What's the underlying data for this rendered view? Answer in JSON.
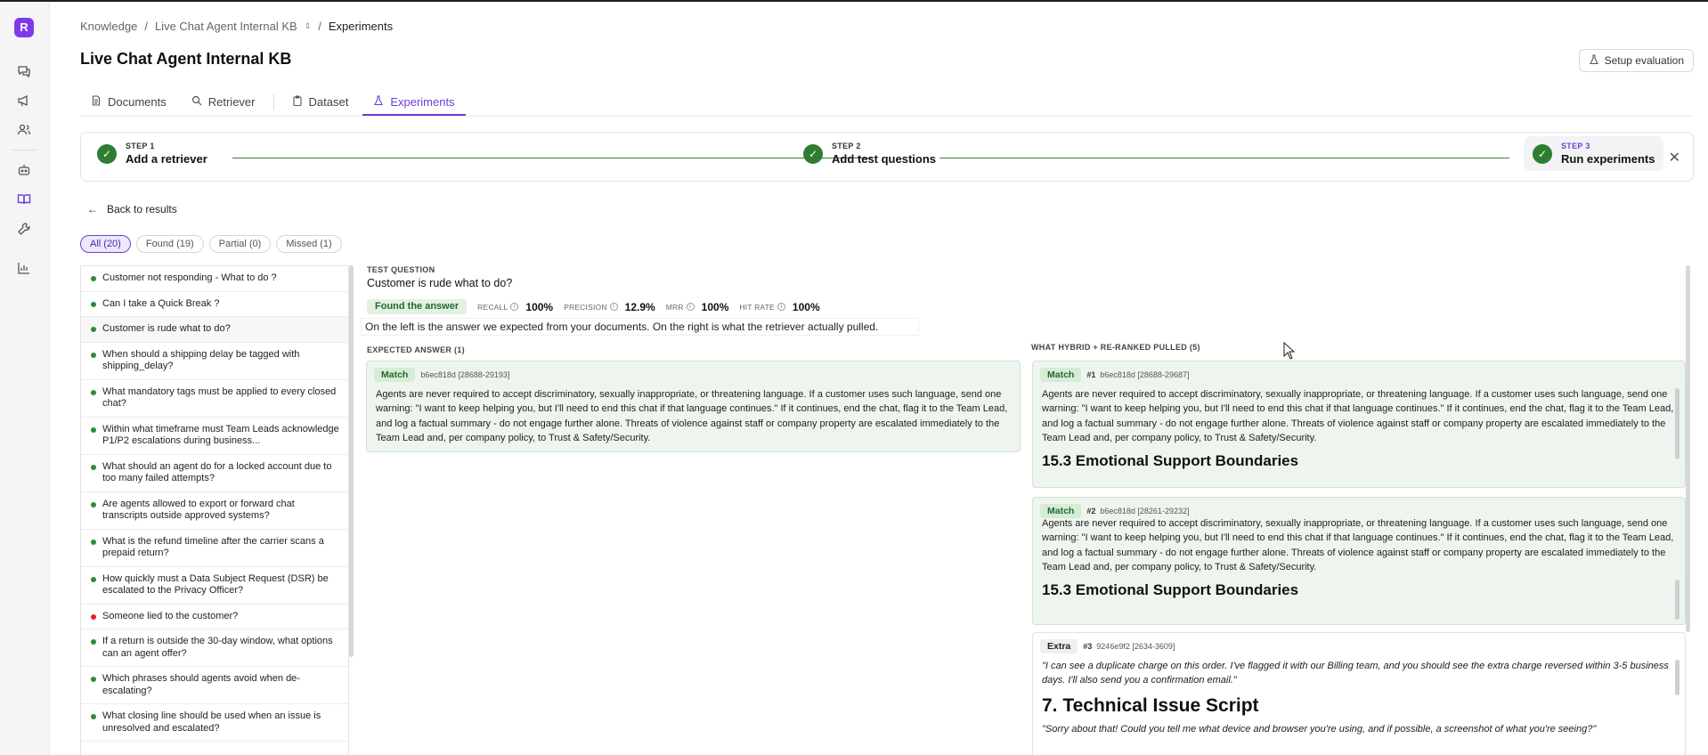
{
  "breadcrumb": {
    "root": "Knowledge",
    "kb": "Live Chat Agent Internal KB",
    "current": "Experiments"
  },
  "page": {
    "title": "Live Chat Agent Internal KB",
    "setup_button": "Setup evaluation"
  },
  "tabs": [
    {
      "label": "Documents",
      "icon": "document-icon"
    },
    {
      "label": "Retriever",
      "icon": "search-icon"
    },
    {
      "label": "Dataset",
      "icon": "clipboard-icon"
    },
    {
      "label": "Experiments",
      "icon": "flask-icon",
      "active": true
    }
  ],
  "steps": [
    {
      "step": "STEP 1",
      "label": "Add a retriever"
    },
    {
      "step": "STEP 2",
      "label": "Add test questions"
    },
    {
      "step": "STEP 3",
      "label": "Run experiments"
    }
  ],
  "back_label": "Back to results",
  "filters": [
    {
      "label": "All (20)",
      "active": true
    },
    {
      "label": "Found (19)"
    },
    {
      "label": "Partial (0)"
    },
    {
      "label": "Missed (1)"
    }
  ],
  "questions": [
    {
      "text": "Customer not responding - What to do ?",
      "status": "found"
    },
    {
      "text": "Can I take a Quick Break ?",
      "status": "found"
    },
    {
      "text": "Customer is rude what to do?",
      "status": "found",
      "selected": true
    },
    {
      "text": "When should a shipping delay be tagged with shipping_delay?",
      "status": "found"
    },
    {
      "text": "What mandatory tags must be applied to every closed chat?",
      "status": "found"
    },
    {
      "text": "Within what timeframe must Team Leads acknowledge P1/P2 escalations during business...",
      "status": "found"
    },
    {
      "text": "What should an agent do for a locked account due to too many failed attempts?",
      "status": "found"
    },
    {
      "text": "Are agents allowed to export or forward chat transcripts outside approved systems?",
      "status": "found"
    },
    {
      "text": "What is the refund timeline after the carrier scans a prepaid return?",
      "status": "found"
    },
    {
      "text": "How quickly must a Data Subject Request (DSR) be escalated to the Privacy Officer?",
      "status": "found"
    },
    {
      "text": "Someone lied to the customer?",
      "status": "missed"
    },
    {
      "text": "If a return is outside the 30-day window, what options can an agent offer?",
      "status": "found"
    },
    {
      "text": "Which phrases should agents avoid when de-escalating?",
      "status": "found"
    },
    {
      "text": "What closing line should be used when an issue is unresolved and escalated?",
      "status": "found"
    }
  ],
  "detail": {
    "tq_label": "TEST QUESTION",
    "question": "Customer is rude what to do?",
    "result": "Found the answer",
    "metrics": [
      {
        "label": "RECALL",
        "value": "100%"
      },
      {
        "label": "PRECISION",
        "value": "12.9%"
      },
      {
        "label": "MRR",
        "value": "100%"
      },
      {
        "label": "HIT RATE",
        "value": "100%"
      }
    ],
    "explanation": "On the left is the answer we expected from your documents. On the right is what the retriever actually pulled.",
    "expected_header": "EXPECTED ANSWER (1)",
    "pulled_header": "WHAT HYBRID + RE-RANKED PULLED (5)",
    "expected": {
      "badge": "Match",
      "id": "b6ec818d [28688-29193]",
      "text": "Agents are never required to accept discriminatory, sexually inappropriate, or threatening language. If a customer uses such language, send one warning: \"I want to keep helping you, but I'll need to end this chat if that language continues.\" If it continues, end the chat, flag it to the Team Lead, and log a factual summary - do not engage further alone. Threats of violence against staff or company property are escalated immediately to the Team Lead and, per company policy, to Trust & Safety/Security."
    },
    "pulled": [
      {
        "badge": "Match",
        "rank": "#1",
        "id": "b6ec818d [28688-29687]",
        "text": "Agents are never required to accept discriminatory, sexually inappropriate, or threatening language. If a customer uses such language, send one warning: \"I want to keep helping you, but I'll need to end this chat if that language continues.\" If it continues, end the chat, flag it to the Team Lead, and log a factual summary - do not engage further alone. Threats of violence against staff or company property are escalated immediately to the Team Lead and, per company policy, to Trust & Safety/Security.",
        "heading": "15.3 Emotional Support Boundaries"
      },
      {
        "badge": "Match",
        "rank": "#2",
        "id": "b6ec818d [28261-29232]",
        "text": "Agents are never required to accept discriminatory, sexually inappropriate, or threatening language. If a customer uses such language, send one warning: \"I want to keep helping you, but I'll need to end this chat if that language continues.\" If it continues, end the chat, flag it to the Team Lead, and log a factual summary - do not engage further alone. Threats of violence against staff or company property are escalated immediately to the Team Lead and, per company policy, to Trust & Safety/Security.",
        "heading": "15.3 Emotional Support Boundaries"
      },
      {
        "badge": "Extra",
        "rank": "#3",
        "id": "9246e9f2 [2634-3609]",
        "text": "\"I can see a duplicate charge on this order. I've flagged it with our Billing team, and you should see the extra charge reversed within 3-5 business days. I'll also send you a confirmation email.\"",
        "heading": "7. Technical Issue Script",
        "text2": "\"Sorry about that! Could you tell me what device and browser you're using, and if possible, a screenshot of what you're seeing?\""
      }
    ]
  }
}
